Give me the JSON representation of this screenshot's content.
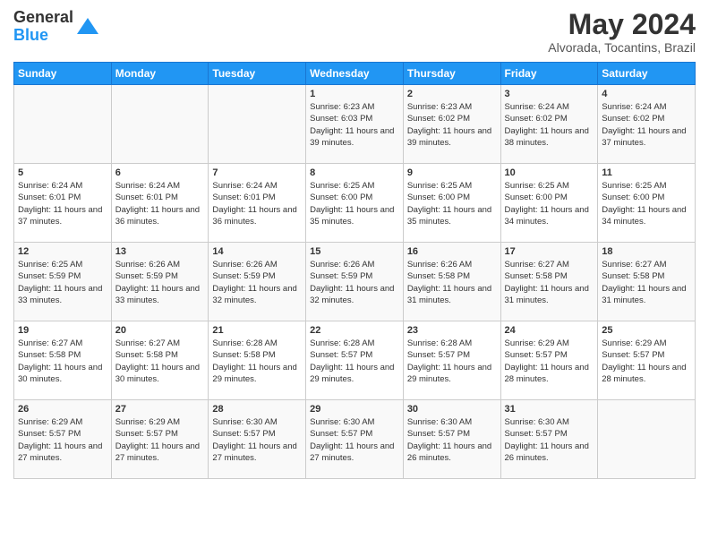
{
  "logo": {
    "general": "General",
    "blue": "Blue"
  },
  "title": "May 2024",
  "subtitle": "Alvorada, Tocantins, Brazil",
  "days_of_week": [
    "Sunday",
    "Monday",
    "Tuesday",
    "Wednesday",
    "Thursday",
    "Friday",
    "Saturday"
  ],
  "weeks": [
    [
      {
        "day": "",
        "info": ""
      },
      {
        "day": "",
        "info": ""
      },
      {
        "day": "",
        "info": ""
      },
      {
        "day": "1",
        "info": "Sunrise: 6:23 AM\nSunset: 6:03 PM\nDaylight: 11 hours and 39 minutes."
      },
      {
        "day": "2",
        "info": "Sunrise: 6:23 AM\nSunset: 6:02 PM\nDaylight: 11 hours and 39 minutes."
      },
      {
        "day": "3",
        "info": "Sunrise: 6:24 AM\nSunset: 6:02 PM\nDaylight: 11 hours and 38 minutes."
      },
      {
        "day": "4",
        "info": "Sunrise: 6:24 AM\nSunset: 6:02 PM\nDaylight: 11 hours and 37 minutes."
      }
    ],
    [
      {
        "day": "5",
        "info": "Sunrise: 6:24 AM\nSunset: 6:01 PM\nDaylight: 11 hours and 37 minutes."
      },
      {
        "day": "6",
        "info": "Sunrise: 6:24 AM\nSunset: 6:01 PM\nDaylight: 11 hours and 36 minutes."
      },
      {
        "day": "7",
        "info": "Sunrise: 6:24 AM\nSunset: 6:01 PM\nDaylight: 11 hours and 36 minutes."
      },
      {
        "day": "8",
        "info": "Sunrise: 6:25 AM\nSunset: 6:00 PM\nDaylight: 11 hours and 35 minutes."
      },
      {
        "day": "9",
        "info": "Sunrise: 6:25 AM\nSunset: 6:00 PM\nDaylight: 11 hours and 35 minutes."
      },
      {
        "day": "10",
        "info": "Sunrise: 6:25 AM\nSunset: 6:00 PM\nDaylight: 11 hours and 34 minutes."
      },
      {
        "day": "11",
        "info": "Sunrise: 6:25 AM\nSunset: 6:00 PM\nDaylight: 11 hours and 34 minutes."
      }
    ],
    [
      {
        "day": "12",
        "info": "Sunrise: 6:25 AM\nSunset: 5:59 PM\nDaylight: 11 hours and 33 minutes."
      },
      {
        "day": "13",
        "info": "Sunrise: 6:26 AM\nSunset: 5:59 PM\nDaylight: 11 hours and 33 minutes."
      },
      {
        "day": "14",
        "info": "Sunrise: 6:26 AM\nSunset: 5:59 PM\nDaylight: 11 hours and 32 minutes."
      },
      {
        "day": "15",
        "info": "Sunrise: 6:26 AM\nSunset: 5:59 PM\nDaylight: 11 hours and 32 minutes."
      },
      {
        "day": "16",
        "info": "Sunrise: 6:26 AM\nSunset: 5:58 PM\nDaylight: 11 hours and 31 minutes."
      },
      {
        "day": "17",
        "info": "Sunrise: 6:27 AM\nSunset: 5:58 PM\nDaylight: 11 hours and 31 minutes."
      },
      {
        "day": "18",
        "info": "Sunrise: 6:27 AM\nSunset: 5:58 PM\nDaylight: 11 hours and 31 minutes."
      }
    ],
    [
      {
        "day": "19",
        "info": "Sunrise: 6:27 AM\nSunset: 5:58 PM\nDaylight: 11 hours and 30 minutes."
      },
      {
        "day": "20",
        "info": "Sunrise: 6:27 AM\nSunset: 5:58 PM\nDaylight: 11 hours and 30 minutes."
      },
      {
        "day": "21",
        "info": "Sunrise: 6:28 AM\nSunset: 5:58 PM\nDaylight: 11 hours and 29 minutes."
      },
      {
        "day": "22",
        "info": "Sunrise: 6:28 AM\nSunset: 5:57 PM\nDaylight: 11 hours and 29 minutes."
      },
      {
        "day": "23",
        "info": "Sunrise: 6:28 AM\nSunset: 5:57 PM\nDaylight: 11 hours and 29 minutes."
      },
      {
        "day": "24",
        "info": "Sunrise: 6:29 AM\nSunset: 5:57 PM\nDaylight: 11 hours and 28 minutes."
      },
      {
        "day": "25",
        "info": "Sunrise: 6:29 AM\nSunset: 5:57 PM\nDaylight: 11 hours and 28 minutes."
      }
    ],
    [
      {
        "day": "26",
        "info": "Sunrise: 6:29 AM\nSunset: 5:57 PM\nDaylight: 11 hours and 27 minutes."
      },
      {
        "day": "27",
        "info": "Sunrise: 6:29 AM\nSunset: 5:57 PM\nDaylight: 11 hours and 27 minutes."
      },
      {
        "day": "28",
        "info": "Sunrise: 6:30 AM\nSunset: 5:57 PM\nDaylight: 11 hours and 27 minutes."
      },
      {
        "day": "29",
        "info": "Sunrise: 6:30 AM\nSunset: 5:57 PM\nDaylight: 11 hours and 27 minutes."
      },
      {
        "day": "30",
        "info": "Sunrise: 6:30 AM\nSunset: 5:57 PM\nDaylight: 11 hours and 26 minutes."
      },
      {
        "day": "31",
        "info": "Sunrise: 6:30 AM\nSunset: 5:57 PM\nDaylight: 11 hours and 26 minutes."
      },
      {
        "day": "",
        "info": ""
      }
    ]
  ]
}
